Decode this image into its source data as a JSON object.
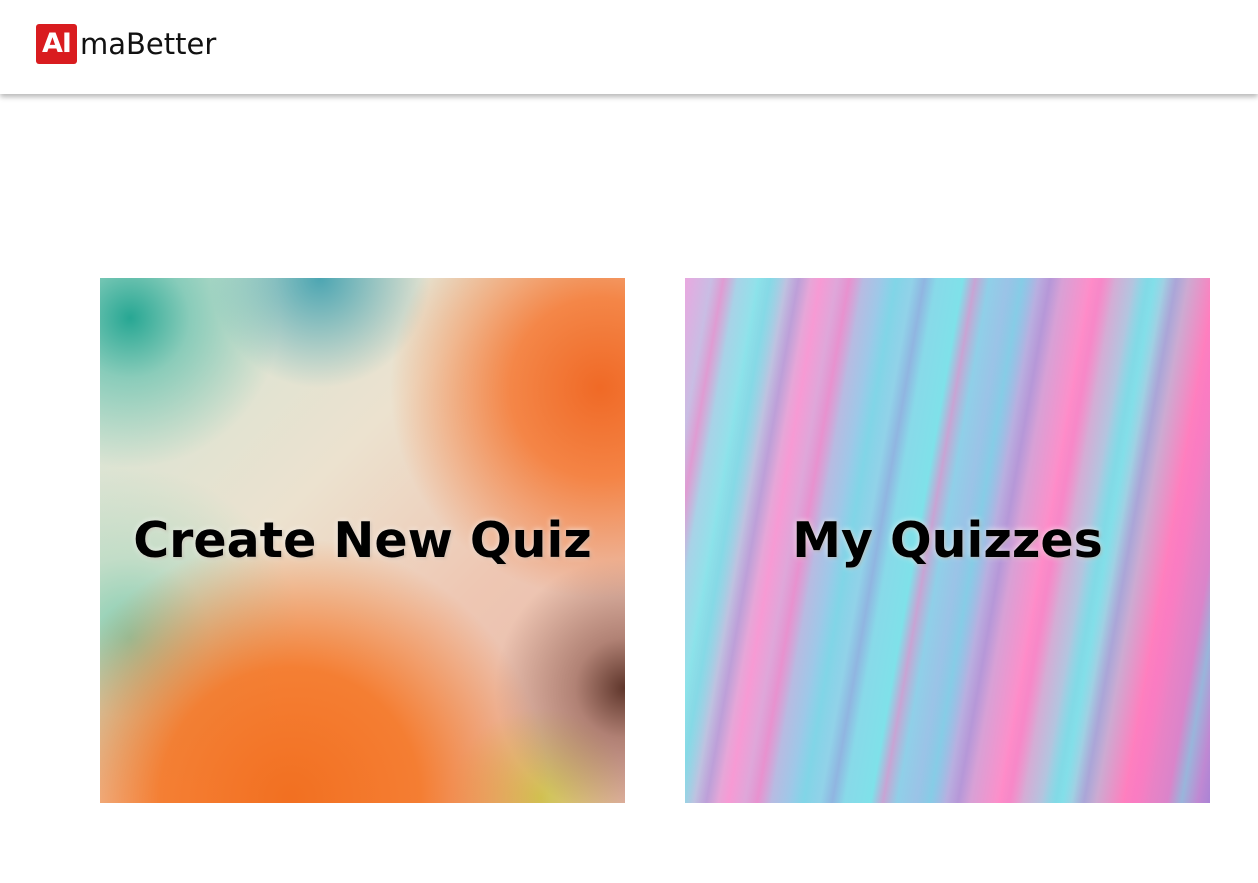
{
  "header": {
    "logo_mark": "AI",
    "logo_text": "maBetter"
  },
  "cards": [
    {
      "label": "Create New Quiz"
    },
    {
      "label": "My Quizzes"
    }
  ],
  "colors": {
    "brand_red": "#d91c1f",
    "background": "#ffffff",
    "text": "#000000"
  }
}
